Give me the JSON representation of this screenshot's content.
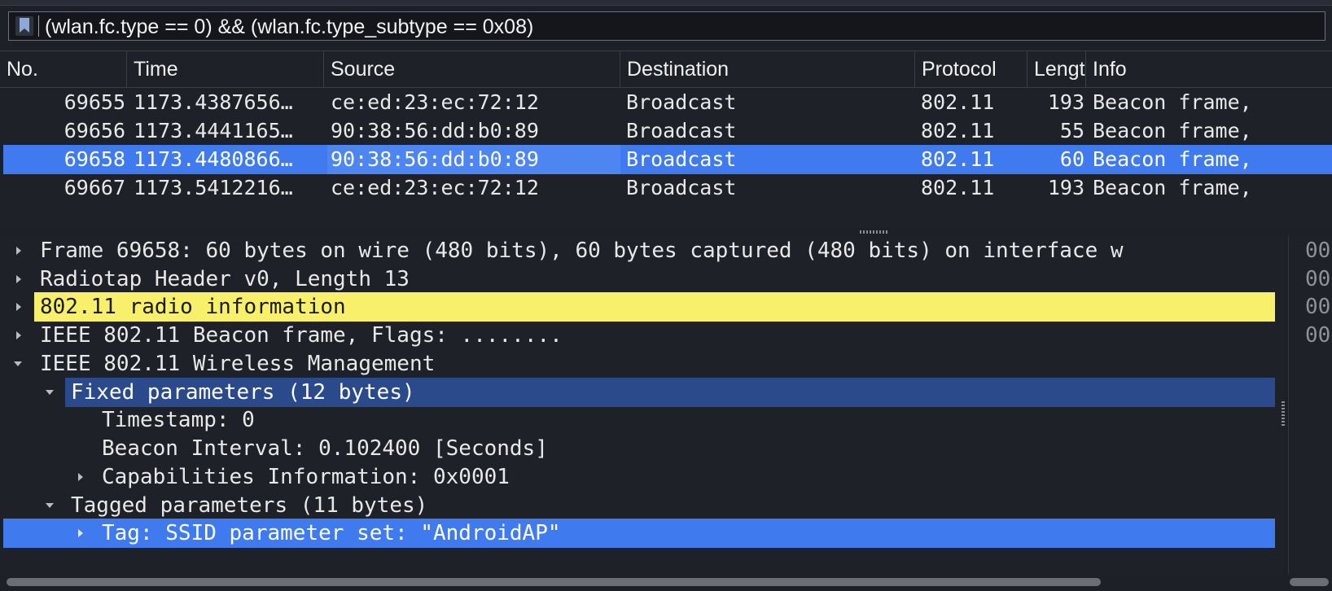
{
  "filter": {
    "expression": "(wlan.fc.type == 0) && (wlan.fc.type_subtype == 0x08)",
    "bookmark_icon": "bookmark-icon"
  },
  "packet_list": {
    "columns": [
      "No.",
      "Time",
      "Source",
      "Destination",
      "Protocol",
      "Lengt",
      "Info"
    ],
    "rows": [
      {
        "no": "69655",
        "time": "1173.4387656…",
        "source": "ce:ed:23:ec:72:12",
        "destination": "Broadcast",
        "protocol": "802.11",
        "length": "193",
        "info": "Beacon frame,",
        "selected": false
      },
      {
        "no": "69656",
        "time": "1173.4441165…",
        "source": "90:38:56:dd:b0:89",
        "destination": "Broadcast",
        "protocol": "802.11",
        "length": "55",
        "info": "Beacon frame,",
        "selected": false
      },
      {
        "no": "69658",
        "time": "1173.4480866…",
        "source": "90:38:56:dd:b0:89",
        "destination": "Broadcast",
        "protocol": "802.11",
        "length": "60",
        "info": "Beacon frame,",
        "selected": true
      },
      {
        "no": "69667",
        "time": "1173.5412216…",
        "source": "ce:ed:23:ec:72:12",
        "destination": "Broadcast",
        "protocol": "802.11",
        "length": "193",
        "info": "Beacon frame,",
        "selected": false
      }
    ]
  },
  "details": {
    "items": [
      {
        "label": "Frame 69658: 60 bytes on wire (480 bits), 60 bytes captured (480 bits) on interface w",
        "expander": "right",
        "highlight": "none"
      },
      {
        "label": "Radiotap Header v0, Length 13",
        "expander": "right",
        "highlight": "none"
      },
      {
        "label": "802.11 radio information",
        "expander": "right",
        "highlight": "yellow"
      },
      {
        "label": "IEEE 802.11 Beacon frame, Flags: ........",
        "expander": "right",
        "highlight": "none"
      },
      {
        "label": "IEEE 802.11 Wireless Management",
        "expander": "down",
        "highlight": "none"
      },
      {
        "label": "Fixed parameters (12 bytes)",
        "expander": "down",
        "highlight": "dark-blue"
      },
      {
        "label": "Timestamp: 0",
        "expander": "none",
        "highlight": "none"
      },
      {
        "label": "Beacon Interval: 0.102400 [Seconds]",
        "expander": "none",
        "highlight": "none"
      },
      {
        "label": "Capabilities Information: 0x0001",
        "expander": "right",
        "highlight": "none"
      },
      {
        "label": "Tagged parameters (11 bytes)",
        "expander": "down",
        "highlight": "none"
      },
      {
        "label": "Tag: SSID parameter set: \"AndroidAP\"",
        "expander": "right",
        "highlight": "blue"
      }
    ]
  },
  "bytes": {
    "lines": [
      "00",
      "00",
      "00",
      "00"
    ]
  },
  "colors": {
    "selection_blue": "#3f7bef",
    "field_dark_blue": "#2b4a8c",
    "highlight_yellow": "#f8f06b"
  }
}
